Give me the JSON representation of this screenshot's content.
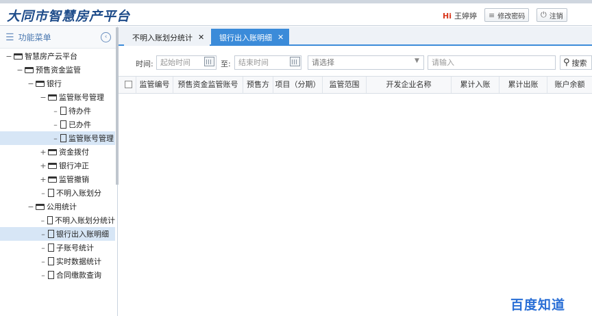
{
  "header": {
    "logo": "大同市智慧房产平台",
    "greeting": "Hi",
    "username": "王婷婷",
    "change_password": "修改密码",
    "logout": "注销"
  },
  "sidebar": {
    "title": "功能菜单",
    "tree": [
      {
        "label": "智慧房产云平台",
        "type": "folder",
        "toggle": "−"
      },
      {
        "label": "预售资金监管",
        "type": "folder",
        "toggle": "−"
      },
      {
        "label": "银行",
        "type": "folder",
        "toggle": "−"
      },
      {
        "label": "监管账号管理",
        "type": "folder",
        "toggle": "−"
      },
      {
        "label": "待办件",
        "type": "file"
      },
      {
        "label": "已办件",
        "type": "file"
      },
      {
        "label": "监管账号管理",
        "type": "file",
        "selected": true
      },
      {
        "label": "资金拨付",
        "type": "folder",
        "toggle": "+"
      },
      {
        "label": "银行冲正",
        "type": "folder",
        "toggle": "+"
      },
      {
        "label": "监管撤销",
        "type": "folder",
        "toggle": "+"
      },
      {
        "label": "不明入账划分",
        "type": "file"
      },
      {
        "label": "公用统计",
        "type": "folder",
        "toggle": "−"
      },
      {
        "label": "不明入账划分统计",
        "type": "file"
      },
      {
        "label": "银行出入账明细",
        "type": "file",
        "selected": true
      },
      {
        "label": "子账号统计",
        "type": "file"
      },
      {
        "label": "实时数据统计",
        "type": "file"
      },
      {
        "label": "合同缴款查询",
        "type": "file"
      }
    ]
  },
  "tabs": [
    {
      "label": "不明入账划分统计",
      "active": false
    },
    {
      "label": "银行出入账明细",
      "active": true
    }
  ],
  "filters": {
    "time_label": "时间:",
    "start_placeholder": "起始时间",
    "to_label": "至:",
    "end_placeholder": "结束时间",
    "select_placeholder": "请选择",
    "input_placeholder": "请输入",
    "search_label": "搜索"
  },
  "table": {
    "columns": [
      "监管编号",
      "预售资金监管账号",
      "预售方",
      "项目（分期）",
      "监管范围",
      "开发企业名称",
      "累计入账",
      "累计出账",
      "账户余额"
    ]
  },
  "watermark": "百度知道"
}
